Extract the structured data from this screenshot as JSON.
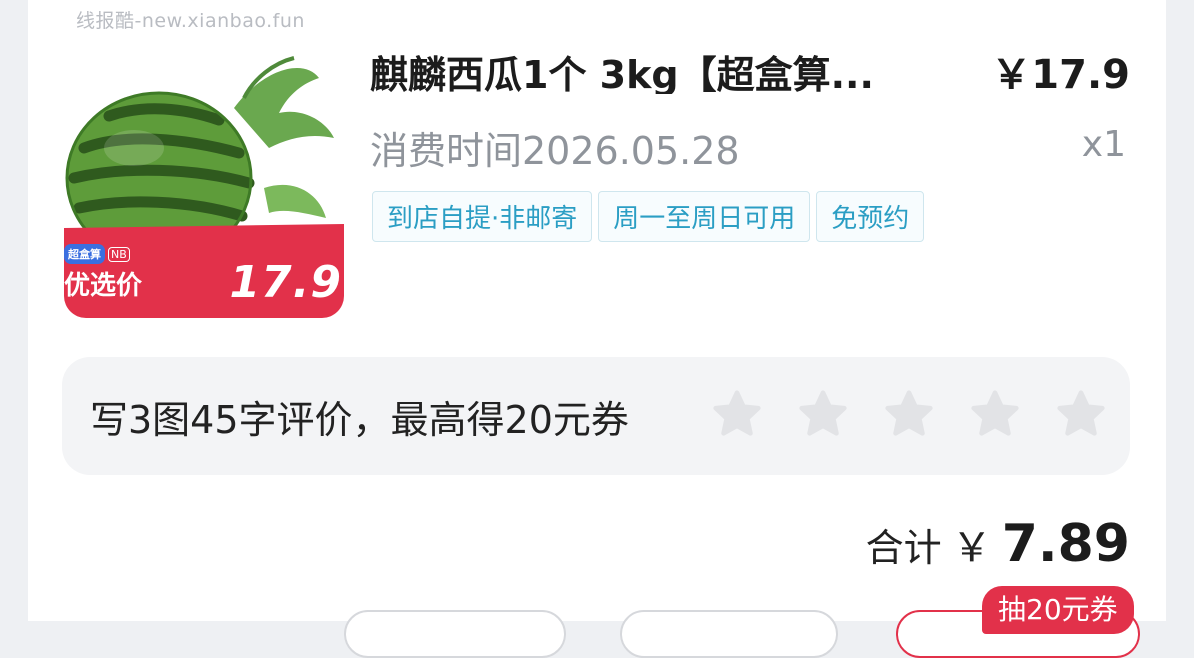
{
  "watermark": "线报酷-new.xianbao.fun",
  "product": {
    "image_label": "优选价",
    "image_price": "17.9",
    "image_brand": "超盒算",
    "image_brand_badge": "NB",
    "title": "麒麟西瓜1个 3kg【超盒算...",
    "price": "￥17.9",
    "consume_time": "消费时间2026.05.28",
    "quantity": "x1",
    "tags": [
      "到店自提·非邮寄",
      "周一至周日可用",
      "免预约"
    ]
  },
  "review": {
    "prompt": "写3图45字评价，最高得20元券",
    "star_count": 5,
    "rating": 0
  },
  "total": {
    "label": "合计",
    "currency": "￥",
    "amount": "7.89"
  },
  "coupon_badge": "抽20元券",
  "colors": {
    "accent_red": "#e2314a",
    "tag_blue": "#2b9ec4",
    "muted_text": "#8f949b",
    "star_gray": "#e2e3e6"
  }
}
